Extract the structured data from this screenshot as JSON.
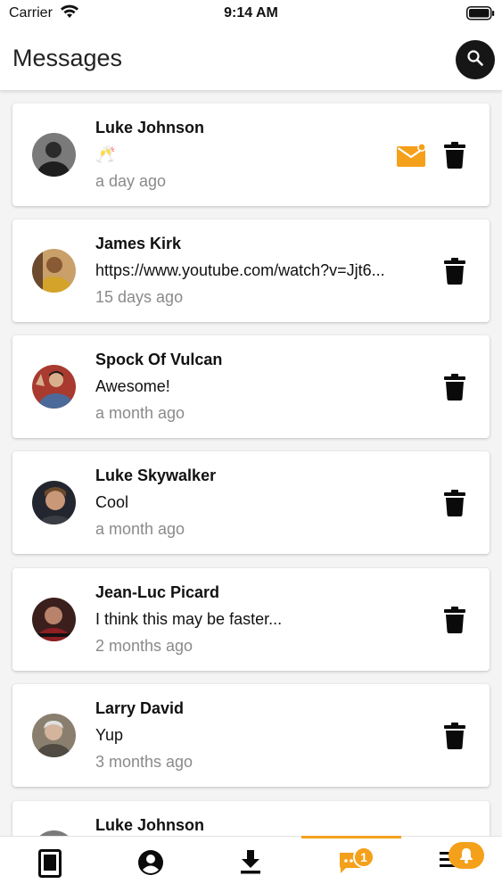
{
  "status_bar": {
    "carrier": "Carrier",
    "time": "9:14 AM"
  },
  "header": {
    "title": "Messages"
  },
  "messages": [
    {
      "sender": "Luke Johnson",
      "snippet": "🥂",
      "time": "a day ago",
      "unread": true
    },
    {
      "sender": "James Kirk",
      "snippet": "https://www.youtube.com/watch?v=Jjt6...",
      "time": "15 days ago",
      "unread": false
    },
    {
      "sender": "Spock Of Vulcan",
      "snippet": "Awesome!",
      "time": "a month ago",
      "unread": false
    },
    {
      "sender": "Luke Skywalker",
      "snippet": "Cool",
      "time": "a month ago",
      "unread": false
    },
    {
      "sender": "Jean-Luc Picard",
      "snippet": "I think this may be faster...",
      "time": "2 months ago",
      "unread": false
    },
    {
      "sender": "Larry David",
      "snippet": "Yup",
      "time": "3 months ago",
      "unread": false
    },
    {
      "sender": "Luke Johnson",
      "snippet": "",
      "time": "",
      "unread": false
    }
  ],
  "bottom_nav": {
    "tabs": [
      {
        "icon": "book-icon"
      },
      {
        "icon": "account-icon"
      },
      {
        "icon": "download-icon"
      },
      {
        "icon": "chat-icon",
        "badge": "1",
        "active": true
      },
      {
        "icon": "menu-icon",
        "badge_icon": "bell-icon"
      }
    ]
  },
  "colors": {
    "accent": "#f5a01a",
    "dark": "#161616",
    "muted_text": "#8a8a8a"
  }
}
